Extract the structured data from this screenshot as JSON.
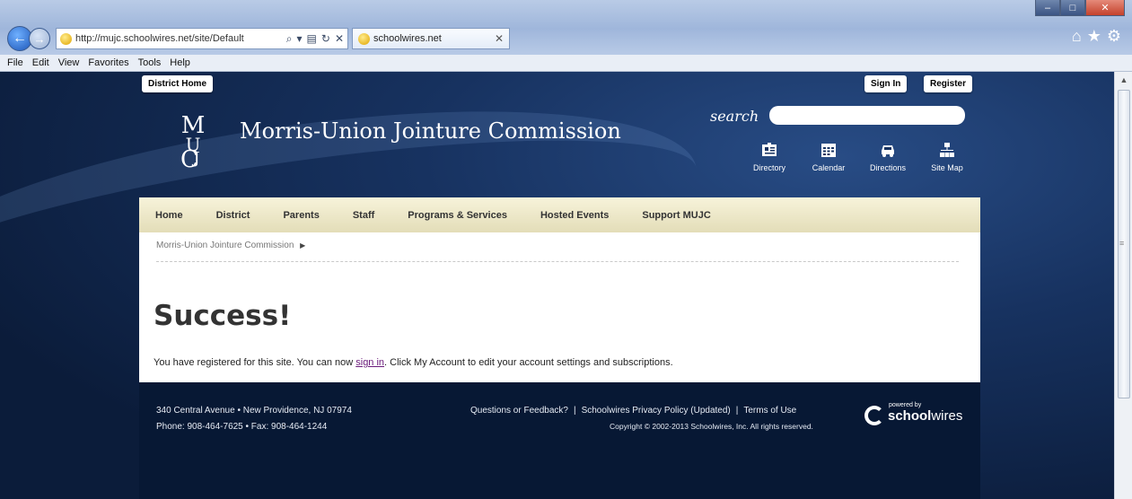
{
  "browser": {
    "url": "http://mujc.schoolwires.net/site/Default",
    "tab_title": "schoolwires.net",
    "menu": [
      "File",
      "Edit",
      "View",
      "Favorites",
      "Tools",
      "Help"
    ]
  },
  "site": {
    "top_left_button": "District Home",
    "sign_in": "Sign In",
    "register": "Register",
    "logo_text": "MUJC",
    "name": "Morris-Union Jointure Commission",
    "search_label": "search",
    "quick_links": [
      {
        "label": "Directory",
        "icon": "directory-icon"
      },
      {
        "label": "Calendar",
        "icon": "calendar-icon"
      },
      {
        "label": "Directions",
        "icon": "car-icon"
      },
      {
        "label": "Site Map",
        "icon": "sitemap-icon"
      }
    ],
    "nav": [
      "Home",
      "District",
      "Parents",
      "Staff",
      "Programs & Services",
      "Hosted Events",
      "Support MUJC"
    ],
    "breadcrumb": "Morris-Union Jointure Commission",
    "heading": "Success!",
    "message_before": "You have registered for this site. You can now ",
    "message_link": "sign in",
    "message_after": ". Click My Account to edit your account settings and subscriptions."
  },
  "footer": {
    "address_line1": "340 Central Avenue • New Providence, NJ 07974",
    "address_line2": "Phone: 908-464-7625 • Fax: 908-464-1244",
    "link_feedback": "Questions or Feedback?",
    "link_privacy": "Schoolwires Privacy Policy (Updated)",
    "link_terms": "Terms of Use",
    "copyright": "Copyright © 2002-2013 Schoolwires, Inc. All rights reserved.",
    "powered_by": "powered by",
    "brand_bold": "school",
    "brand_light": "wires"
  }
}
